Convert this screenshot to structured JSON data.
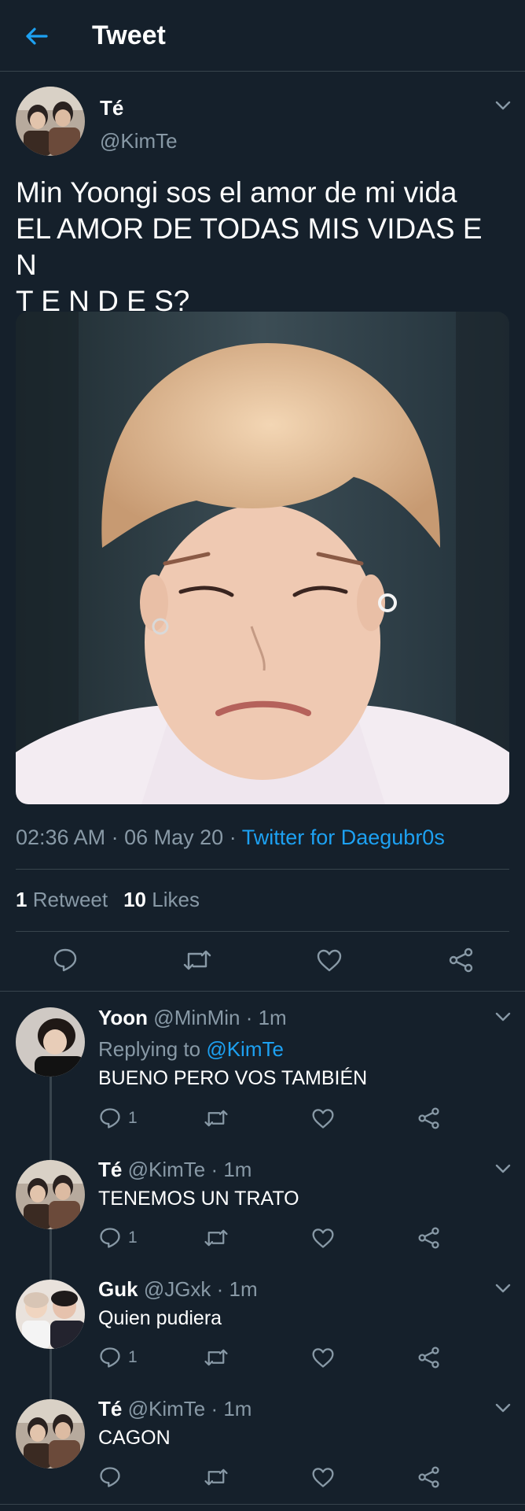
{
  "header": {
    "title": "Tweet",
    "back_icon": "arrow-left-icon"
  },
  "tweet": {
    "author_name": "Té",
    "author_handle": "@KimTe",
    "text": "Min Yoongi sos el amor de mi vida\nEL AMOR DE TODAS MIS VIDAS E N\nT E N D E S?",
    "time": "02:36 AM",
    "date": "06 May 20",
    "sep": "·",
    "source": "Twitter for Daegubr0s",
    "retweets_count": "1",
    "retweets_label": "Retweet",
    "likes_count": "10",
    "likes_label": "Likes",
    "actions": [
      "reply-icon",
      "retweet-icon",
      "like-icon",
      "share-icon"
    ]
  },
  "replies": [
    {
      "name": "Yoon",
      "handle": "@MinMin",
      "time": "· 1m",
      "replying_prefix": "Replying to",
      "replying_to": "@KimTe",
      "text": "BUENO PERO VOS TAMBIÉN",
      "reply_count": "1"
    },
    {
      "name": "Té",
      "handle": "@KimTe",
      "time": "· 1m",
      "text": "TENEMOS UN TRATO",
      "reply_count": "1"
    },
    {
      "name": "Guk",
      "handle": "@JGxk",
      "time": "· 1m",
      "text": "Quien pudiera",
      "reply_count": "1"
    },
    {
      "name": "Té",
      "handle": "@KimTe",
      "time": "· 1m",
      "text": "CAGON",
      "reply_count": ""
    }
  ],
  "colors": {
    "background": "#15202b",
    "accent": "#1da1f2",
    "secondary_text": "#8899a6",
    "divider": "#38444d"
  }
}
